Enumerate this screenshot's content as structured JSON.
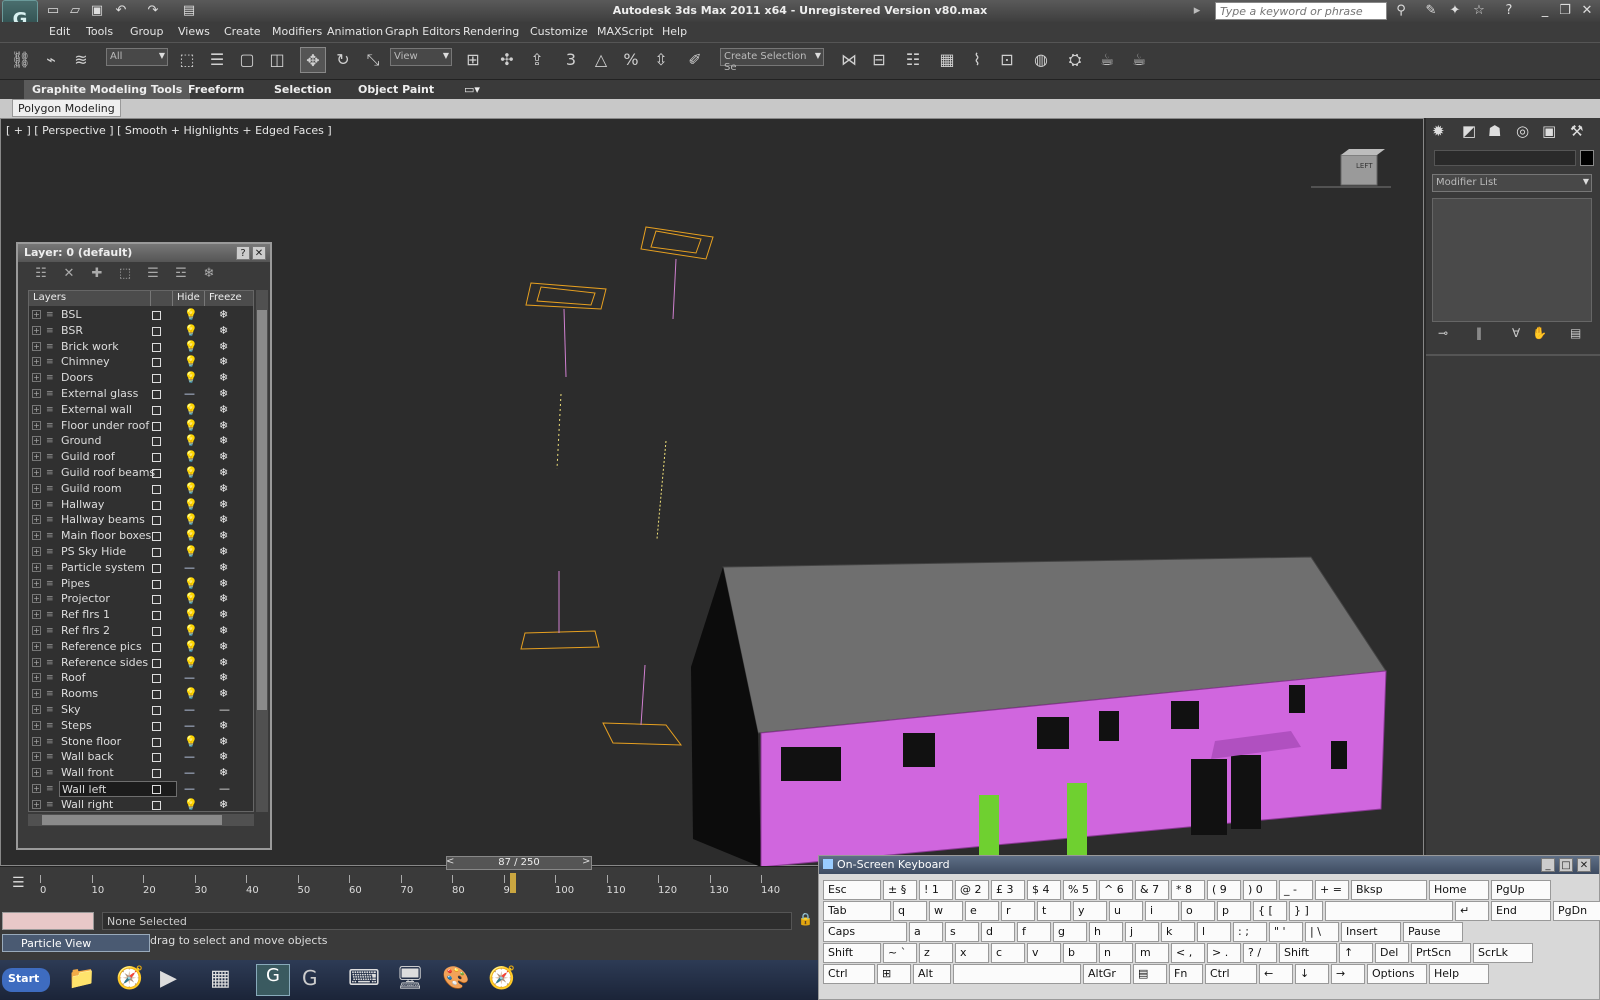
{
  "window": {
    "title": "Autodesk 3ds Max  2011 x64  -  Unregistered Version    v80.max",
    "search_placeholder": "Type a keyword or phrase"
  },
  "menus": [
    "Edit",
    "Tools",
    "Group",
    "Views",
    "Create",
    "Modifiers",
    "Animation",
    "Graph Editors",
    "Rendering",
    "Customize",
    "MAXScript",
    "Help"
  ],
  "toolbar": {
    "selection_filter": "All",
    "ref_coord": "View",
    "named_selection": "Create Selection Se"
  },
  "ribbon": {
    "tabs": [
      "Graphite Modeling Tools",
      "Freeform",
      "Selection",
      "Object Paint"
    ],
    "subtab": "Polygon Modeling"
  },
  "viewport": {
    "label": "[ + ] [ Perspective ] [ Smooth + Highlights + Edged Faces ]",
    "viewcube": "LEFT"
  },
  "command_panel": {
    "modifier_list": "Modifier List"
  },
  "layer_dialog": {
    "title": "Layer: 0 (default)",
    "columns": [
      "Layers",
      "Hide",
      "Freeze"
    ],
    "layers": [
      "BSL",
      "BSR",
      "Brick work",
      "Chimney",
      "Doors",
      "External glass",
      "External wall",
      "Floor under roof",
      "Ground",
      "Guild roof",
      "Guild roof beams",
      "Guild room",
      "Hallway",
      "Hallway beams",
      "Main floor boxes",
      "PS Sky Hide",
      "Particle system",
      "Pipes",
      "Projector",
      "Ref flrs 1",
      "Ref flrs 2",
      "Reference pics",
      "Reference sides",
      "Roof",
      "Rooms",
      "Sky",
      "Steps",
      "Stone floor",
      "Wall back",
      "Wall front",
      "Wall left",
      "Wall right"
    ],
    "selected": "Wall left"
  },
  "timeline": {
    "frame": "87 / 250",
    "ticks": [
      "0",
      "10",
      "20",
      "30",
      "40",
      "50",
      "60",
      "70",
      "80",
      "90",
      "100",
      "110",
      "120",
      "130",
      "140"
    ]
  },
  "status": {
    "selection": "None Selected",
    "prompt": "drag to select and move objects",
    "particle_view": "Particle View"
  },
  "taskbar": {
    "start": "Start"
  },
  "osk": {
    "title": "On-Screen Keyboard",
    "rows": [
      [
        "Esc",
        "± §",
        "! 1",
        "@ 2",
        "£ 3",
        "$ 4",
        "% 5",
        "^ 6",
        "& 7",
        "* 8",
        "( 9",
        ") 0",
        "_ -",
        "+ =",
        "Bksp",
        "Home",
        "PgUp"
      ],
      [
        "Tab",
        "q",
        "w",
        "e",
        "r",
        "t",
        "y",
        "u",
        "i",
        "o",
        "p",
        "{ [",
        "} ]",
        "",
        "↵",
        "End",
        "PgDn"
      ],
      [
        "Caps",
        "a",
        "s",
        "d",
        "f",
        "g",
        "h",
        "j",
        "k",
        "l",
        ": ;",
        "\" '",
        "| \\",
        "Insert",
        "Pause"
      ],
      [
        "Shift",
        "~ `",
        "z",
        "x",
        "c",
        "v",
        "b",
        "n",
        "m",
        "< ,",
        "> .",
        "? /",
        "Shift",
        "↑",
        "Del",
        "PrtScn",
        "ScrLk"
      ],
      [
        "Ctrl",
        "⊞",
        "Alt",
        "",
        "AltGr",
        "▤",
        "Fn",
        "Ctrl",
        "←",
        "↓",
        "→",
        "Options",
        "Help"
      ]
    ]
  }
}
